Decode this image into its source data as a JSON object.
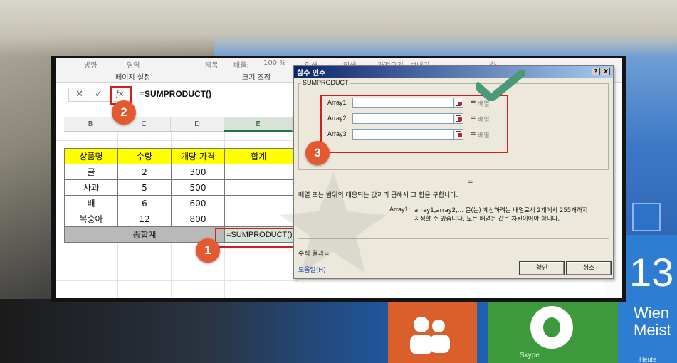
{
  "background": {
    "clock_tile": {
      "number": "13",
      "line1": "Wien",
      "line2": "Meist",
      "line3": "Heute"
    },
    "skype_label": "Skype"
  },
  "ribbon": {
    "top_items": [
      "방향",
      "영역",
      "제목",
      "배율:",
      "100 %",
      "인쇄",
      "인쇄",
      "가져오기",
      "보내기",
      "하"
    ],
    "groups": [
      "페이지 설정",
      "크기 조정"
    ]
  },
  "formula_bar": {
    "cancel_symbol": "✕",
    "enter_symbol": "✓",
    "fx_label": "fx",
    "formula": "=SUMPRODUCT()"
  },
  "columns": [
    "B",
    "C",
    "D",
    "E"
  ],
  "table": {
    "headers": [
      "상품명",
      "수량",
      "개당 가격",
      "합계"
    ],
    "rows": [
      [
        "귤",
        "2",
        "300",
        ""
      ],
      [
        "사과",
        "5",
        "500",
        ""
      ],
      [
        "배",
        "6",
        "600",
        ""
      ],
      [
        "복숭아",
        "12",
        "800",
        ""
      ]
    ],
    "total_label": "종합계",
    "total_formula": "=SUMPRODUCT()"
  },
  "dialog": {
    "title": "함수 인수",
    "help_button": "?",
    "close_button": "X",
    "function_name": "SUMPRODUCT",
    "args": [
      {
        "label": "Array1",
        "value": "",
        "type": "배열"
      },
      {
        "label": "Array2",
        "value": "",
        "type": "배열"
      },
      {
        "label": "Array3",
        "value": "",
        "type": "배열"
      }
    ],
    "equals": "=",
    "result_equals": "=",
    "description": "배열 또는 범위의 대응되는 값끼리 곱해서 그 합을 구합니다.",
    "arg_name": "Array1:",
    "arg_help_line1": "array1,array2,... 은(는) 계산하려는 배열로서 2개에서 255개까지",
    "arg_help_line2": "지정할 수 있습니다. 모든 배열은 같은 차원이어야 합니다.",
    "result_label": "수식 결과=",
    "help_link": "도움말(H)",
    "ok_label": "확인",
    "cancel_label": "취소"
  },
  "markers": {
    "step1": "1",
    "step2": "2",
    "step3": "3"
  },
  "colors": {
    "marker": "#e35a30",
    "highlight_box": "#d11f1f",
    "header_fill": "#ffff00",
    "checkmark": "#4a9a7a"
  }
}
